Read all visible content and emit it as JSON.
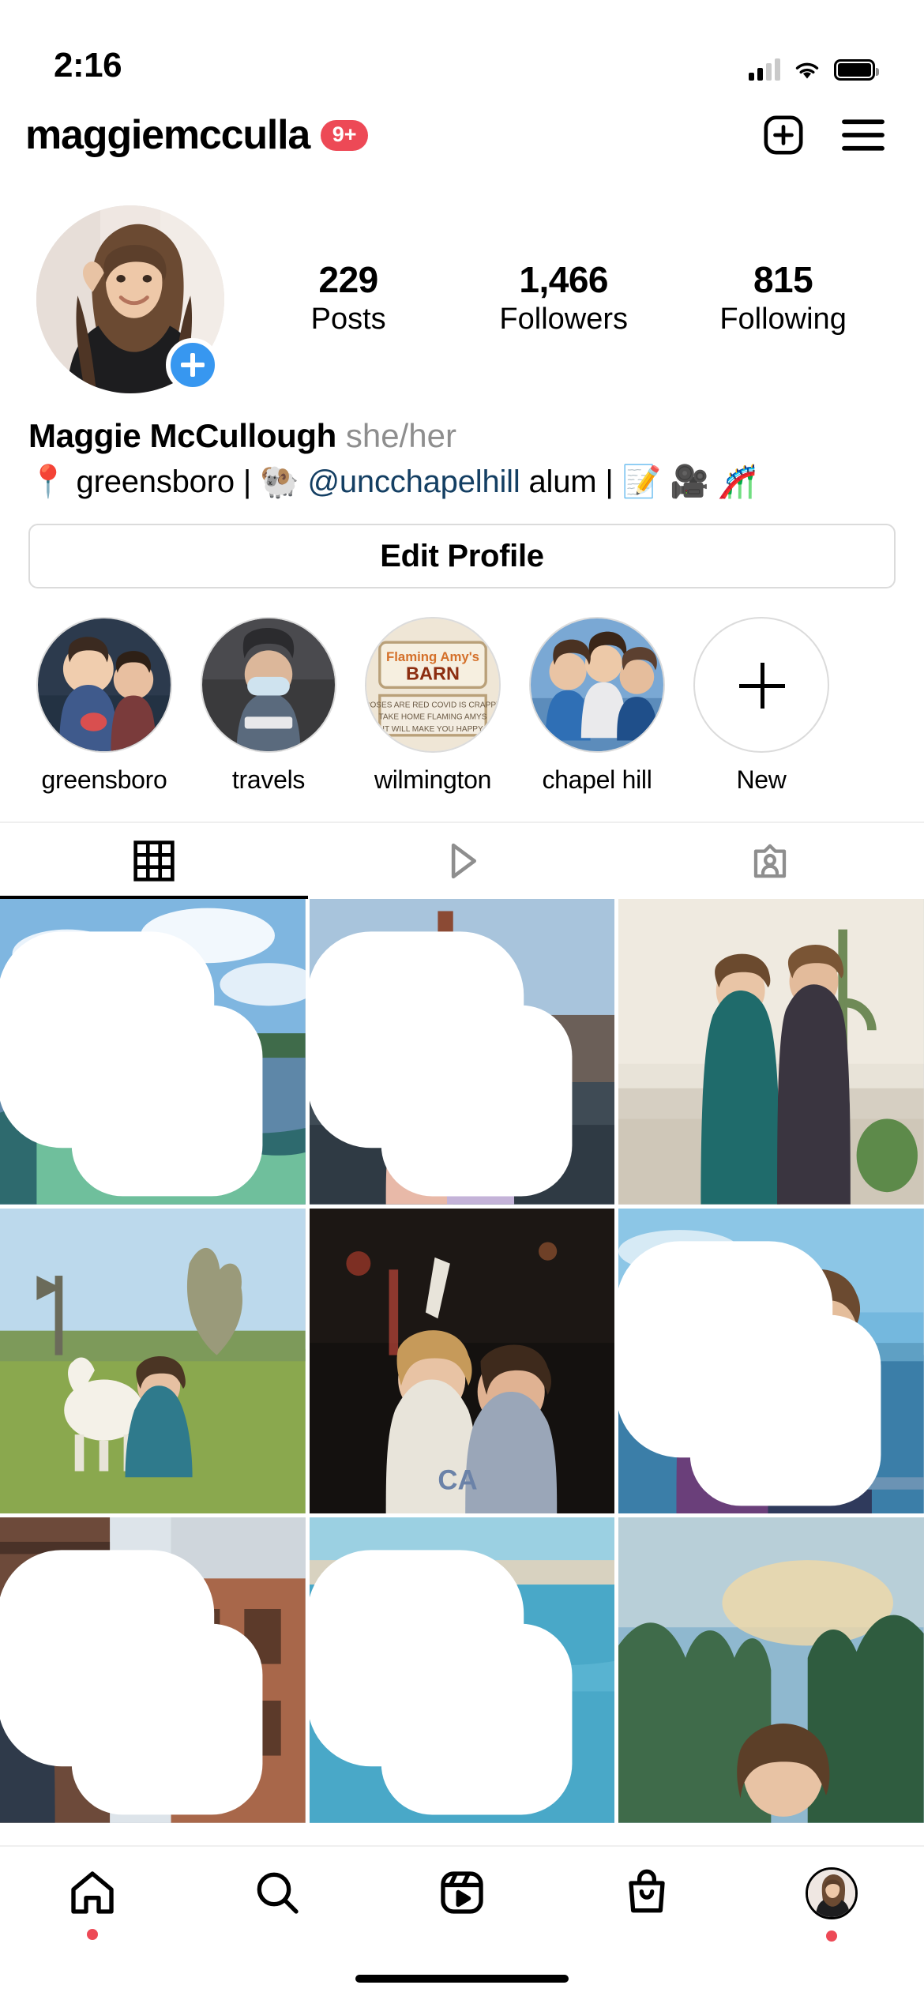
{
  "status_bar": {
    "time": "2:16",
    "cellular_icon": "cellular-signal-icon",
    "wifi_icon": "wifi-icon",
    "battery_icon": "battery-full-icon"
  },
  "header": {
    "username": "maggiemcculla",
    "notification_badge": "9+",
    "badge_color": "#ed4956",
    "new_post_icon": "plus-square-icon",
    "menu_icon": "hamburger-menu-icon"
  },
  "profile": {
    "avatar_alt": "profile-photo",
    "add_story_icon": "plus-circle-icon",
    "add_story_color": "#3797f0",
    "stats": [
      {
        "value": "229",
        "label": "Posts"
      },
      {
        "value": "1,466",
        "label": "Followers"
      },
      {
        "value": "815",
        "label": "Following"
      }
    ],
    "display_name": "Maggie McCullough",
    "pronouns": "she/her",
    "bio": {
      "pin_emoji": "📍",
      "location": "greensboro",
      "sep1": "|",
      "ram_emoji": "🐏",
      "mention": "@uncchapelhill",
      "mention_color": "#143f63",
      "alum_text": "alum",
      "sep2": "|",
      "emoji_writing": "📝",
      "emoji_camera": "🎥",
      "emoji_coaster": "🎢"
    },
    "edit_profile_label": "Edit Profile"
  },
  "highlights": [
    {
      "label": "greensboro",
      "icon": "story-highlight-cover"
    },
    {
      "label": "travels",
      "icon": "story-highlight-cover"
    },
    {
      "label": "wilmington",
      "icon": "story-highlight-cover"
    },
    {
      "label": "chapel hill",
      "icon": "story-highlight-cover"
    },
    {
      "label": "New",
      "icon": "plus-icon"
    }
  ],
  "tabs": [
    {
      "name": "grid",
      "icon": "grid-icon",
      "active": true
    },
    {
      "name": "reels",
      "icon": "play-triangle-icon",
      "active": false
    },
    {
      "name": "tagged",
      "icon": "tagged-person-icon",
      "active": false
    }
  ],
  "grid_posts": [
    {
      "alt": "kayaking-on-lake",
      "carousel": true
    },
    {
      "alt": "concert-stadium-two-people",
      "carousel": true
    },
    {
      "alt": "couple-in-greenhouse",
      "carousel": false
    },
    {
      "alt": "person-with-horse-in-field",
      "carousel": false
    },
    {
      "alt": "friends-at-night-event",
      "carousel": false
    },
    {
      "alt": "couple-kissing-by-ocean",
      "carousel": true
    },
    {
      "alt": "brick-building-street",
      "carousel": true
    },
    {
      "alt": "beach-water-selfie",
      "carousel": true
    },
    {
      "alt": "sunset-palm-trees-selfie",
      "carousel": false
    }
  ],
  "bottom_nav": [
    {
      "name": "home",
      "icon": "home-icon",
      "dot": true
    },
    {
      "name": "search",
      "icon": "search-icon",
      "dot": false
    },
    {
      "name": "reels",
      "icon": "reels-icon",
      "dot": false
    },
    {
      "name": "shop",
      "icon": "shop-bag-icon",
      "dot": false
    },
    {
      "name": "profile",
      "icon": "profile-avatar-icon",
      "dot": true
    }
  ]
}
